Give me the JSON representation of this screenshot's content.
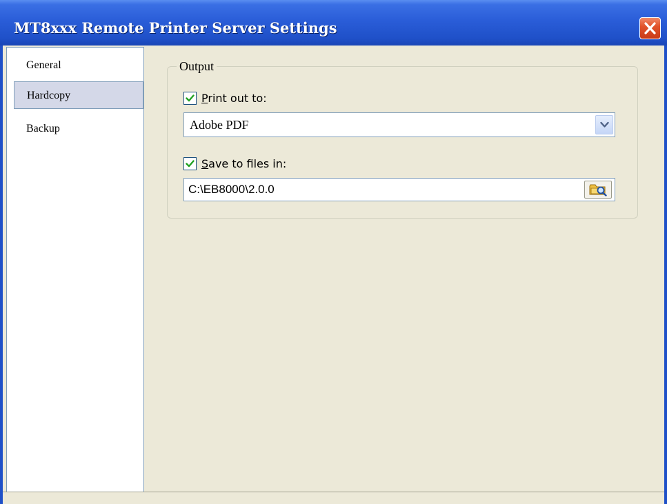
{
  "window": {
    "title": "MT8xxx Remote Printer Server Settings"
  },
  "sidebar": {
    "items": [
      {
        "label": "General",
        "selected": false
      },
      {
        "label": "Hardcopy",
        "selected": true
      },
      {
        "label": "Backup",
        "selected": false
      }
    ]
  },
  "output": {
    "group_label": "Output",
    "print_out": {
      "checked": true,
      "label_accel": "P",
      "label_rest": "rint out to:",
      "printer": "Adobe PDF"
    },
    "save_files": {
      "checked": true,
      "label_accel": "S",
      "label_rest": "ave to files in:",
      "path": "C:\\EB8000\\2.0.0"
    }
  },
  "icons": {
    "close": "close-icon",
    "dropdown": "chevron-down-icon",
    "browse": "folder-browse-icon",
    "check": "checkmark-icon"
  },
  "colors": {
    "titlebar": "#1f50c8",
    "close_button": "#e2542c",
    "window_bg": "#ece9d8",
    "selected_item": "#d4d8e8"
  }
}
